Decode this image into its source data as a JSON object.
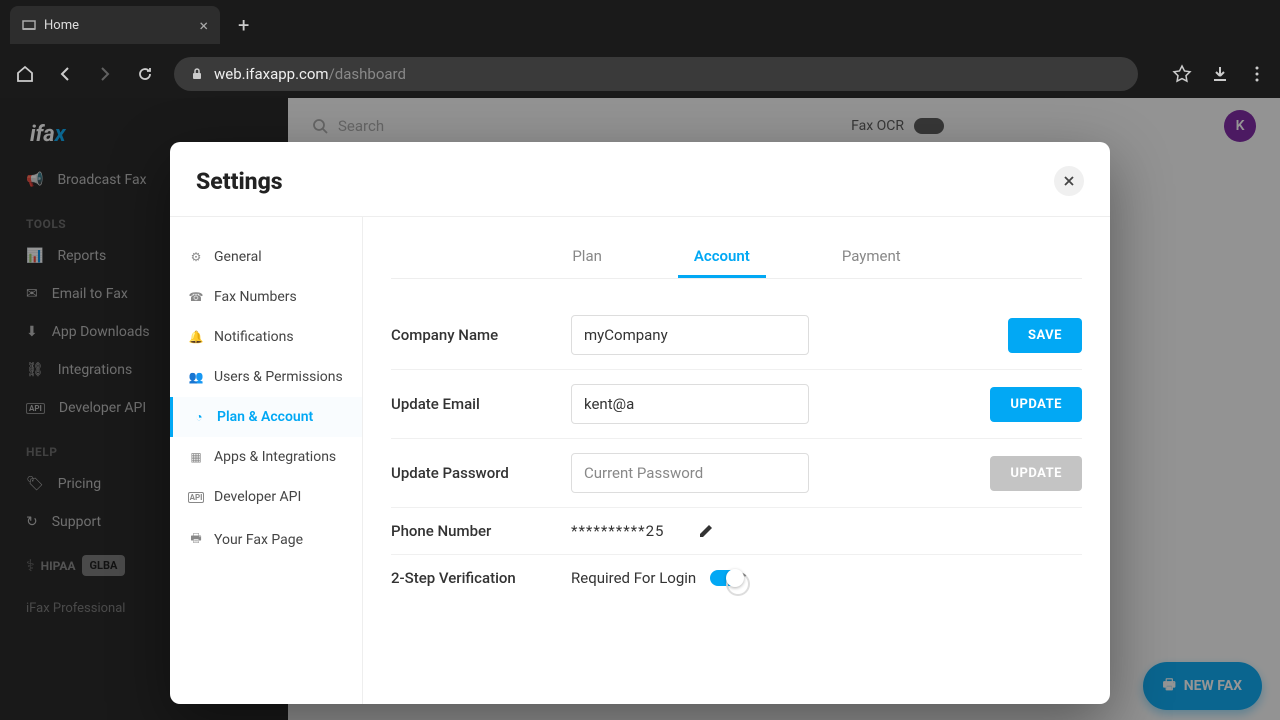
{
  "browser": {
    "tab_title": "Home",
    "url_domain": "web.ifaxapp.com",
    "url_path": "/dashboard"
  },
  "app": {
    "logo": {
      "part1": "i",
      "part2": "fa",
      "part3": "x"
    },
    "sidebar": {
      "broadcast": "Broadcast Fax",
      "group_tools": "TOOLS",
      "reports": "Reports",
      "email_to_fax": "Email to Fax",
      "app_downloads": "App Downloads",
      "integrations": "Integrations",
      "developer_api": "Developer API",
      "group_help": "HELP",
      "pricing": "Pricing",
      "support": "Support",
      "hipaa": "HIPAA",
      "glba": "GLBA",
      "plan": "iFax Professional"
    },
    "header": {
      "search_placeholder": "Search",
      "fax_ocr": "Fax OCR",
      "avatar_letter": "K"
    },
    "new_fax": "NEW FAX"
  },
  "modal": {
    "title": "Settings",
    "side": {
      "general": "General",
      "fax_numbers": "Fax Numbers",
      "notifications": "Notifications",
      "users_permissions": "Users & Permissions",
      "plan_account": "Plan & Account",
      "apps_integrations": "Apps & Integrations",
      "developer_api": "Developer API",
      "your_fax_page": "Your Fax Page"
    },
    "tabs": {
      "plan": "Plan",
      "account": "Account",
      "payment": "Payment"
    },
    "form": {
      "company_label": "Company Name",
      "company_value": "myCompany",
      "save_btn": "SAVE",
      "email_label": "Update Email",
      "email_value": "kent@a",
      "update_btn": "UPDATE",
      "password_label": "Update Password",
      "password_placeholder": "Current Password",
      "phone_label": "Phone Number",
      "phone_masked": "**********25",
      "twostep_label": "2-Step Verification",
      "twostep_text": "Required For Login"
    }
  }
}
